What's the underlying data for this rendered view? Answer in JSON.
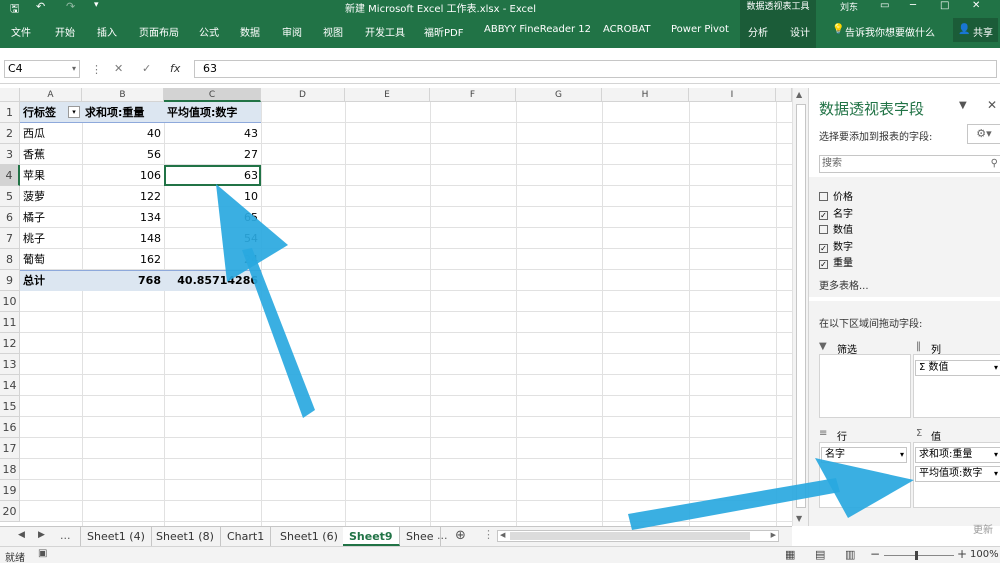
{
  "title": {
    "filename": "新建 Microsoft Excel 工作表.xlsx - Excel",
    "context_tool": "数据透视表工具",
    "user": "刘东"
  },
  "ribbon": {
    "tabs": [
      "文件",
      "开始",
      "插入",
      "页面布局",
      "公式",
      "数据",
      "审阅",
      "视图",
      "开发工具",
      "福昕PDF",
      "ABBYY FineReader 12",
      "ACROBAT",
      "Power Pivot",
      "分析",
      "设计"
    ],
    "tell_me": "告诉我你想要做什么",
    "share": "共享"
  },
  "formula_bar": {
    "name_box": "C4",
    "fx": "fx",
    "value": "63"
  },
  "columns": [
    "A",
    "B",
    "C",
    "D",
    "E",
    "F",
    "G",
    "H",
    "I"
  ],
  "rows": [
    "1",
    "2",
    "3",
    "4",
    "5",
    "6",
    "7",
    "8",
    "9",
    "10",
    "11",
    "12",
    "13",
    "14",
    "15",
    "16",
    "17",
    "18",
    "19",
    "20"
  ],
  "pivot": {
    "headers": [
      "行标签",
      "求和项:重量",
      "平均值项:数字"
    ],
    "rows": [
      {
        "label": "西瓜",
        "weight": "40",
        "avg": "43"
      },
      {
        "label": "香蕉",
        "weight": "56",
        "avg": "27"
      },
      {
        "label": "苹果",
        "weight": "106",
        "avg": "63"
      },
      {
        "label": "菠萝",
        "weight": "122",
        "avg": "10"
      },
      {
        "label": "橘子",
        "weight": "134",
        "avg": "65"
      },
      {
        "label": "桃子",
        "weight": "148",
        "avg": "54"
      },
      {
        "label": "葡萄",
        "weight": "162",
        "avg": "24"
      }
    ],
    "total": {
      "label": "总计",
      "weight": "768",
      "avg": "40.85714286"
    }
  },
  "sheet_tabs": [
    "Sheet1 (4)",
    "Sheet1 (8)",
    "Chart1",
    "Sheet1 (6)",
    "Sheet9",
    "Shee"
  ],
  "sheet_nav": {
    "ellipsis": "..."
  },
  "active_sheet": "Sheet9",
  "status": {
    "mode": "就绪",
    "zoom": "100%"
  },
  "field_pane": {
    "title": "数据透视表字段",
    "subtitle": "选择要添加到报表的字段:",
    "search_placeholder": "搜索",
    "fields": [
      {
        "name": "价格",
        "checked": false
      },
      {
        "name": "名字",
        "checked": true
      },
      {
        "name": "数值",
        "checked": false
      },
      {
        "name": "数字",
        "checked": true
      },
      {
        "name": "重量",
        "checked": true
      }
    ],
    "more_tables": "更多表格...",
    "drag_hint": "在以下区域间拖动字段:",
    "area_filter": "筛选",
    "area_columns": "列",
    "area_rows": "行",
    "area_values": "值",
    "columns_chip": "数值",
    "rows_chip": "名字",
    "values_chips": [
      "求和项:重量",
      "平均值项:数字"
    ],
    "update_button": "更新"
  },
  "colors": {
    "excel_green": "#217346",
    "arrow": "#29a8e0",
    "pivot_header": "#dce6f1"
  }
}
